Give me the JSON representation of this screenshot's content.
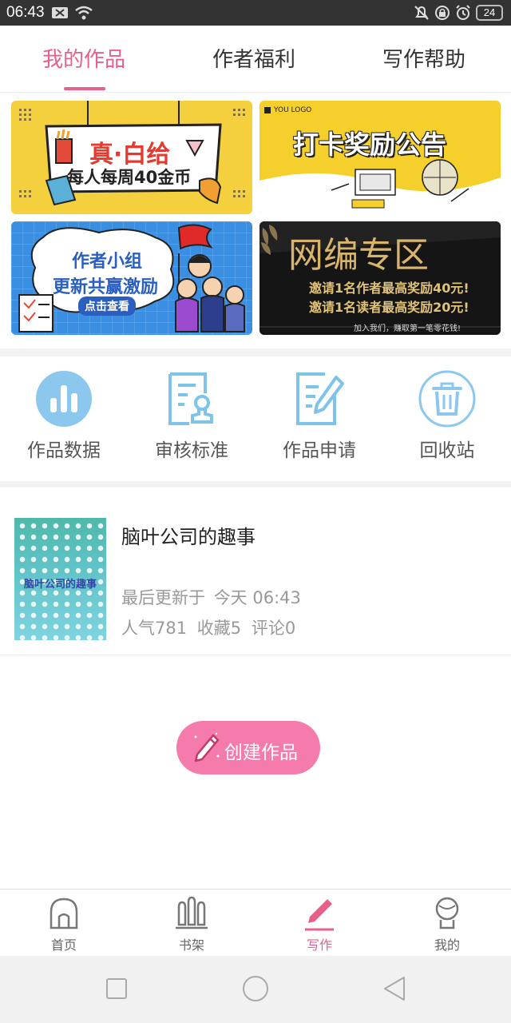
{
  "status_bar": {
    "time": "06:43",
    "battery": "24"
  },
  "tabs": [
    {
      "label": "我的作品",
      "active": true
    },
    {
      "label": "作者福利",
      "active": false
    },
    {
      "label": "写作帮助",
      "active": false
    }
  ],
  "banners": {
    "b1": {
      "line1": "真·白给",
      "line2": "每人每周40金币"
    },
    "b2": {
      "title": "打卡奖励公告",
      "logo": "YOU LOGO"
    },
    "b3": {
      "line1": "作者小组",
      "line2": "更新共赢激励",
      "button": "点击查看"
    },
    "b4": {
      "title": "网编专区",
      "line1": "邀请1名作者最高奖励40元!",
      "line2": "邀请1名读者最高奖励20元!",
      "footer": "加入我们，赚取第一笔零花钱!"
    }
  },
  "quick_actions": [
    {
      "label": "作品数据",
      "icon": "bar-chart-icon"
    },
    {
      "label": "审核标准",
      "icon": "review-standard-icon"
    },
    {
      "label": "作品申请",
      "icon": "edit-document-icon"
    },
    {
      "label": "回收站",
      "icon": "trash-icon"
    }
  ],
  "works": [
    {
      "title": "脑叶公司的趣事",
      "cover_text": "脑叶公司的趣事",
      "last_update_label": "最后更新于",
      "last_update": "今天 06:43",
      "popularity": "人气781",
      "favorites": "收藏5",
      "comments": "评论0"
    }
  ],
  "create_button": "创建作品",
  "bottom_nav": [
    {
      "label": "首页",
      "icon": "home-icon"
    },
    {
      "label": "书架",
      "icon": "bookshelf-icon"
    },
    {
      "label": "写作",
      "icon": "pen-icon",
      "active": true
    },
    {
      "label": "我的",
      "icon": "profile-icon"
    }
  ],
  "colors": {
    "accent": "#e8608a",
    "create_button": "#f57bac",
    "icon_blue": "#7ec4ea"
  }
}
